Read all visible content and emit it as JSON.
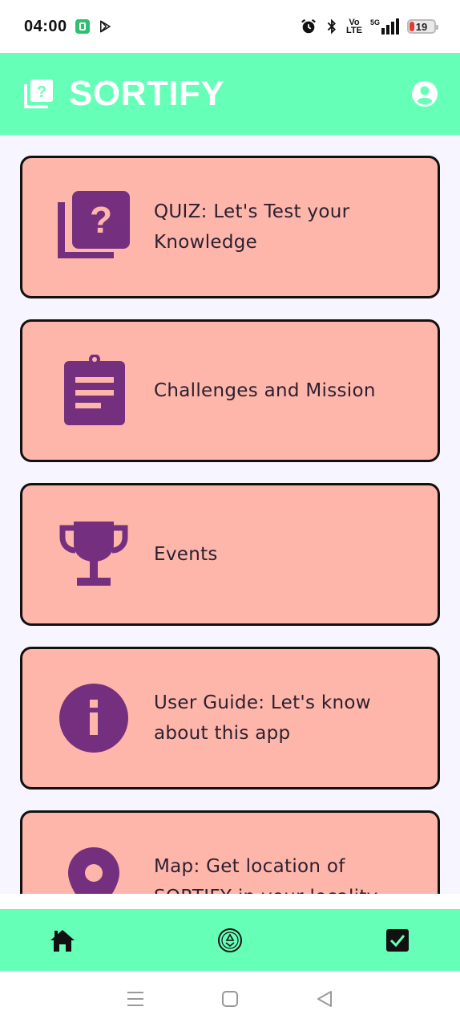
{
  "status_bar": {
    "time": "04:00",
    "network_top": "Vo",
    "network_bottom": "LTE",
    "signal": "5G",
    "battery": "19"
  },
  "app_bar": {
    "title": "SORTIFY",
    "logo_icon": "quiz-icon",
    "profile_icon": "account-circle-icon"
  },
  "cards": [
    {
      "label": "QUIZ: Let's Test your Knowledge",
      "icon": "quiz-icon"
    },
    {
      "label": "Challenges and Mission",
      "icon": "clipboard-icon"
    },
    {
      "label": "Events",
      "icon": "trophy-icon"
    },
    {
      "label": "User Guide: Let's know about this app",
      "icon": "info-icon"
    },
    {
      "label": "Map: Get location of SORTIFY in your locality",
      "icon": "location-pin-icon"
    }
  ],
  "bottom_nav": [
    {
      "icon": "home-icon"
    },
    {
      "icon": "recycle-icon"
    },
    {
      "icon": "check-box-icon"
    }
  ],
  "colors": {
    "app_bar": "#66ffb7",
    "card": "#ffb6aa",
    "icon": "#74307e",
    "background": "#f7f5ff"
  }
}
